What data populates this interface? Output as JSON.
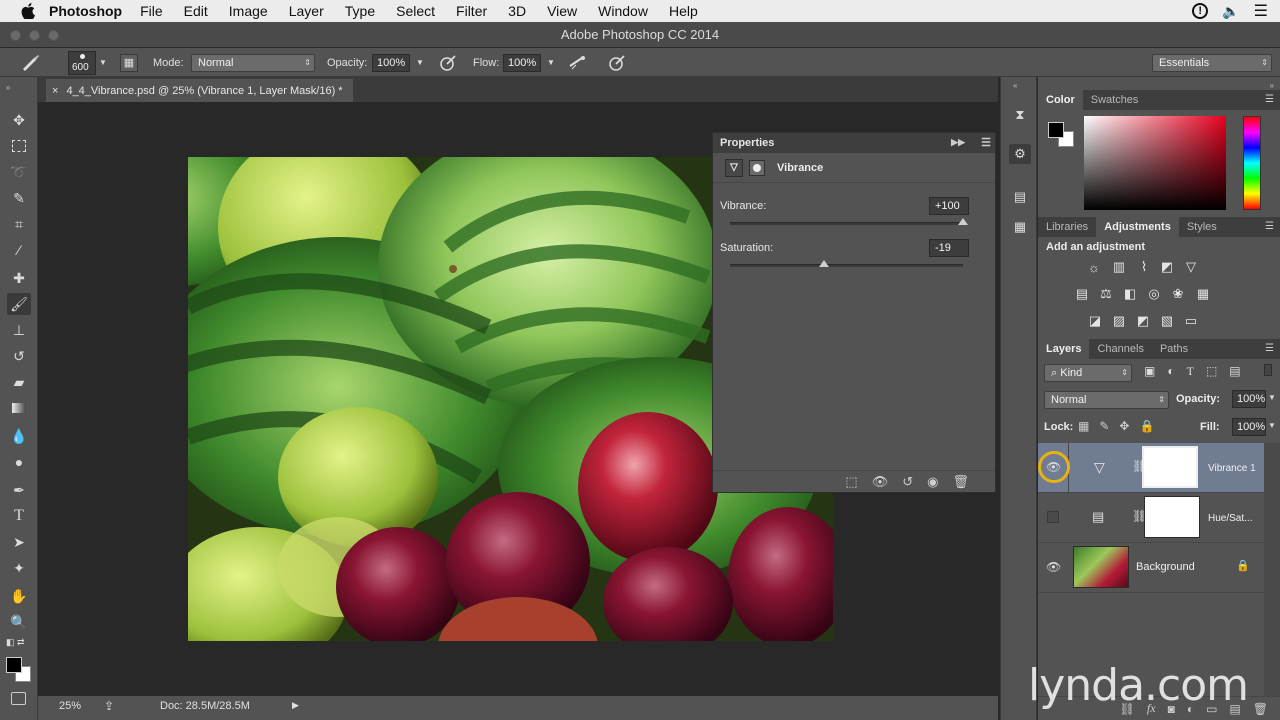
{
  "menubar": {
    "app_name": "Photoshop",
    "items": [
      "File",
      "Edit",
      "Image",
      "Layer",
      "Type",
      "Select",
      "Filter",
      "3D",
      "View",
      "Window",
      "Help"
    ]
  },
  "window": {
    "title": "Adobe Photoshop CC 2014"
  },
  "options_bar": {
    "brush_size": "600",
    "mode_label": "Mode:",
    "mode_value": "Normal",
    "opacity_label": "Opacity:",
    "opacity_value": "100%",
    "flow_label": "Flow:",
    "flow_value": "100%",
    "workspace": "Essentials"
  },
  "document": {
    "tab_title": "4_4_Vibrance.psd @ 25% (Vibrance 1, Layer Mask/16) *",
    "zoom": "25%",
    "doc_size": "Doc: 28.5M/28.5M"
  },
  "properties": {
    "title": "Properties",
    "adjustment_name": "Vibrance",
    "vibrance_label": "Vibrance:",
    "vibrance_value": "+100",
    "vibrance_level": 100,
    "saturation_label": "Saturation:",
    "saturation_value": "-19",
    "saturation_level": -19
  },
  "color_panel": {
    "tabs": [
      "Color",
      "Swatches"
    ]
  },
  "adjustments_panel": {
    "tabs": [
      "Libraries",
      "Adjustments",
      "Styles"
    ],
    "heading": "Add an adjustment"
  },
  "layers_panel": {
    "tabs": [
      "Layers",
      "Channels",
      "Paths"
    ],
    "filter_kind": "Kind",
    "blend_mode": "Normal",
    "opacity_label": "Opacity:",
    "opacity_value": "100%",
    "lock_label": "Lock:",
    "fill_label": "Fill:",
    "fill_value": "100%",
    "layers": [
      {
        "name": "Vibrance 1",
        "visible": true,
        "selected": true
      },
      {
        "name": "Hue/Sat...",
        "visible": false,
        "selected": false
      },
      {
        "name": "Background",
        "visible": true,
        "selected": false
      }
    ]
  },
  "watermark": "lynda.com",
  "colors": {
    "selected_layer": "#6f7c91",
    "panel_bg": "#535353",
    "highlight_ring": "#e8b312"
  }
}
